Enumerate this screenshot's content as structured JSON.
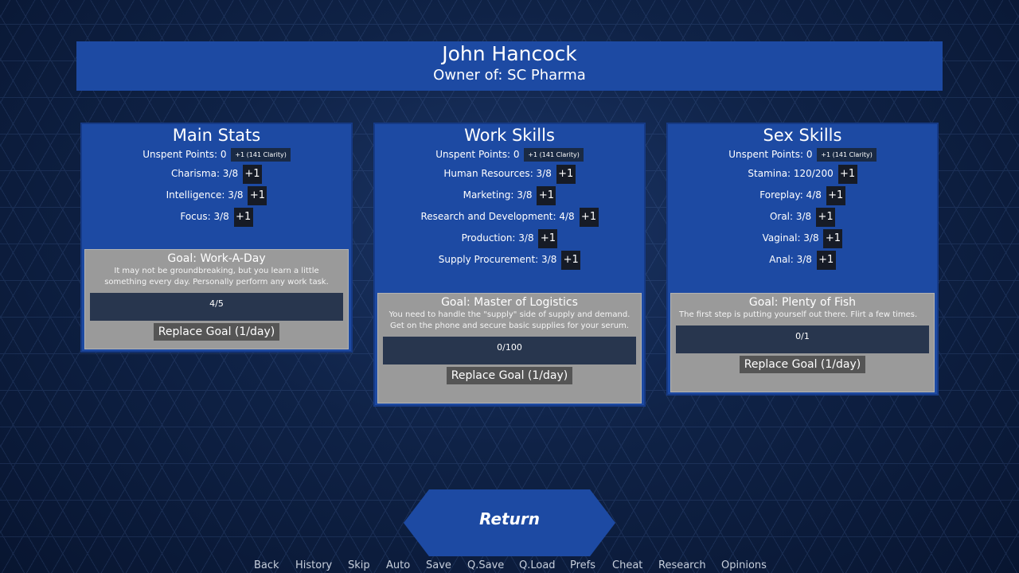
{
  "header": {
    "name": "John Hancock",
    "owner": "Owner of: SC Pharma"
  },
  "panels": [
    {
      "title": "Main Stats",
      "unspent": "Unspent Points: 0",
      "unspent_btn": "+1 (141 Clarity)",
      "stats": [
        {
          "label": "Charisma: 3/8",
          "btn": "+1"
        },
        {
          "label": "Intelligence: 3/8",
          "btn": "+1"
        },
        {
          "label": "Focus: 3/8",
          "btn": "+1"
        }
      ],
      "goal": {
        "title": "Goal: Work-A-Day",
        "desc": "It may not be groundbreaking, but you learn a little something every day. Personally perform any work task.",
        "progress": "4/5",
        "replace": "Replace Goal (1/day)"
      }
    },
    {
      "title": "Work Skills",
      "unspent": "Unspent Points: 0",
      "unspent_btn": "+1 (141 Clarity)",
      "stats": [
        {
          "label": "Human Resources: 3/8",
          "btn": "+1"
        },
        {
          "label": "Marketing: 3/8",
          "btn": "+1"
        },
        {
          "label": "Research and Development: 4/8",
          "btn": "+1"
        },
        {
          "label": "Production: 3/8",
          "btn": "+1"
        },
        {
          "label": "Supply Procurement: 3/8",
          "btn": "+1"
        }
      ],
      "goal": {
        "title": "Goal: Master of Logistics",
        "desc": "You need to handle the \"supply\" side of supply and demand. Get on the phone and secure basic supplies for your serum.",
        "progress": "0/100",
        "replace": "Replace Goal (1/day)"
      }
    },
    {
      "title": "Sex Skills",
      "unspent": "Unspent Points: 0",
      "unspent_btn": "+1 (141 Clarity)",
      "stats": [
        {
          "label": "Stamina: 120/200",
          "btn": "+1"
        },
        {
          "label": "Foreplay: 4/8",
          "btn": "+1"
        },
        {
          "label": "Oral: 3/8",
          "btn": "+1"
        },
        {
          "label": "Vaginal: 3/8",
          "btn": "+1"
        },
        {
          "label": "Anal: 3/8",
          "btn": "+1"
        }
      ],
      "goal": {
        "title": "Goal: Plenty of Fish",
        "desc": "The first step is putting yourself out there. Flirt a few times.",
        "progress": "0/1",
        "replace": "Replace Goal (1/day)"
      }
    }
  ],
  "return_label": "Return",
  "quickmenu": [
    "Back",
    "History",
    "Skip",
    "Auto",
    "Save",
    "Q.Save",
    "Q.Load",
    "Prefs",
    "Cheat",
    "Research",
    "Opinions"
  ]
}
